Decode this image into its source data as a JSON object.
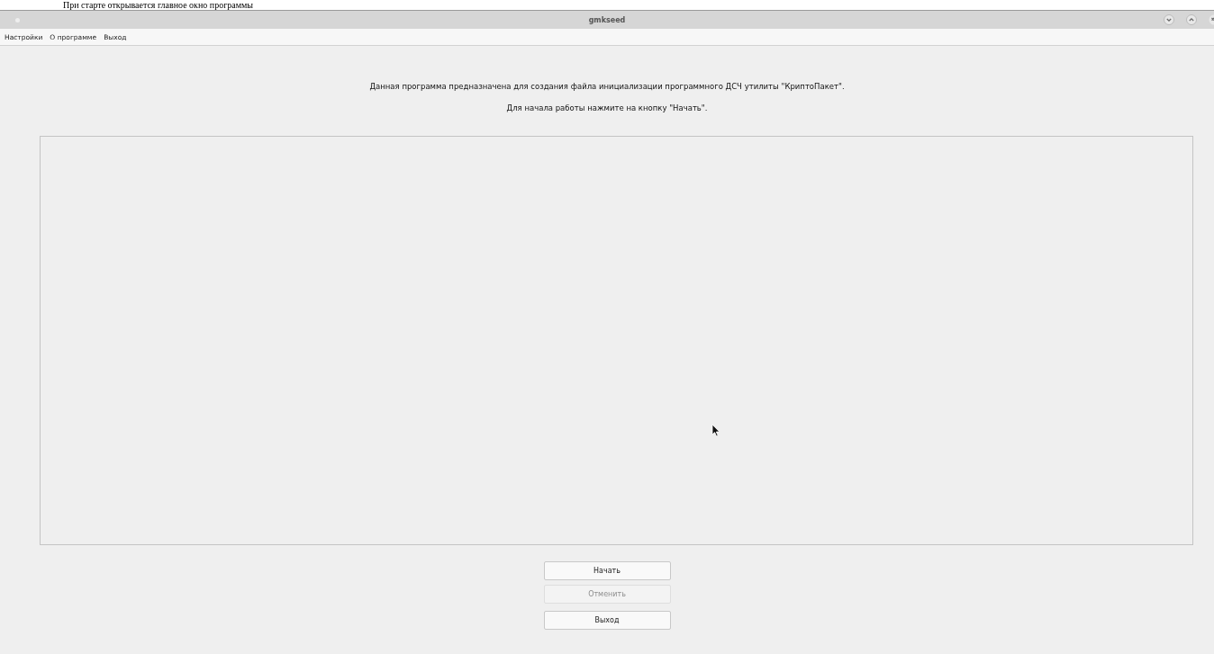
{
  "caption": "При старте открывается главное окно программы",
  "window": {
    "title": "gmkseed"
  },
  "menu": [
    {
      "label": "Настройки"
    },
    {
      "label": "О программе"
    },
    {
      "label": "Выход"
    }
  ],
  "intro": [
    "Данная программа предназначена для создания файла инициализации программного ДСЧ утилиты \"КриптоПакет\".",
    "Для начала работы нажмите на кнопку \"Начать\"."
  ],
  "buttons": [
    {
      "label": "Начать",
      "disabled": false
    },
    {
      "label": "Отменить",
      "disabled": true
    },
    {
      "label": "Выход",
      "disabled": false
    }
  ]
}
